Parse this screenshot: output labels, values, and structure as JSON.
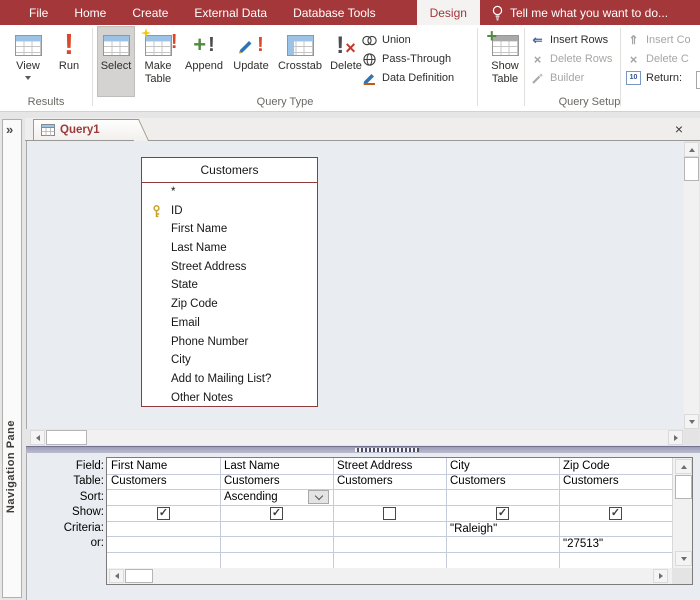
{
  "tabbar": {
    "file": "File",
    "home": "Home",
    "create": "Create",
    "external_data": "External Data",
    "database_tools": "Database Tools",
    "design": "Design",
    "tellme": "Tell me what you want to do..."
  },
  "ribbon": {
    "results": {
      "label": "Results",
      "view": "View",
      "run": "Run"
    },
    "query_type": {
      "label": "Query Type",
      "select": "Select",
      "make_table": "Make Table",
      "append": "Append",
      "update": "Update",
      "crosstab": "Crosstab",
      "delete": "Delete",
      "union": "Union",
      "pass_through": "Pass-Through",
      "data_definition": "Data Definition"
    },
    "query_setup": {
      "label": "Query Setup",
      "show_table": "Show Table",
      "insert_rows": "Insert Rows",
      "delete_rows": "Delete Rows",
      "builder": "Builder",
      "insert_columns": "Insert Co",
      "delete_columns": "Delete C",
      "return": "Return:",
      "return_icon_number": "10"
    }
  },
  "nav": {
    "label": "Navigation Pane",
    "expand": "»"
  },
  "document": {
    "tab_label": "Query1",
    "close": "×"
  },
  "field_list": {
    "title": "Customers",
    "fields": [
      {
        "name": "*",
        "key": false
      },
      {
        "name": "ID",
        "key": true
      },
      {
        "name": "First Name",
        "key": false
      },
      {
        "name": "Last Name",
        "key": false
      },
      {
        "name": "Street Address",
        "key": false
      },
      {
        "name": "State",
        "key": false
      },
      {
        "name": "Zip Code",
        "key": false
      },
      {
        "name": "Email",
        "key": false
      },
      {
        "name": "Phone Number",
        "key": false
      },
      {
        "name": "City",
        "key": false
      },
      {
        "name": "Add to Mailing List?",
        "key": false
      },
      {
        "name": "Other Notes",
        "key": false
      }
    ]
  },
  "grid": {
    "labels": {
      "field": "Field:",
      "table": "Table:",
      "sort": "Sort:",
      "show": "Show:",
      "criteria": "Criteria:",
      "or": "or:"
    },
    "columns": [
      {
        "field": "First Name",
        "table": "Customers",
        "sort": "",
        "show": true,
        "criteria": "",
        "or": ""
      },
      {
        "field": "Last Name",
        "table": "Customers",
        "sort": "Ascending",
        "show": true,
        "criteria": "",
        "or": ""
      },
      {
        "field": "Street Address",
        "table": "Customers",
        "sort": "",
        "show": false,
        "criteria": "",
        "or": ""
      },
      {
        "field": "City",
        "table": "Customers",
        "sort": "",
        "show": true,
        "criteria": "\"Raleigh\"",
        "or": ""
      },
      {
        "field": "Zip Code",
        "table": "Customers",
        "sort": "",
        "show": true,
        "criteria": "",
        "or": "\"27513\""
      }
    ]
  },
  "glyphs": {
    "check": "✓"
  },
  "colors": {
    "ribbon_red": "#a4373a",
    "field_list_border": "#8e3b3e",
    "grid_line": "#c5cbd8",
    "tab_text": "#9c3a38"
  }
}
